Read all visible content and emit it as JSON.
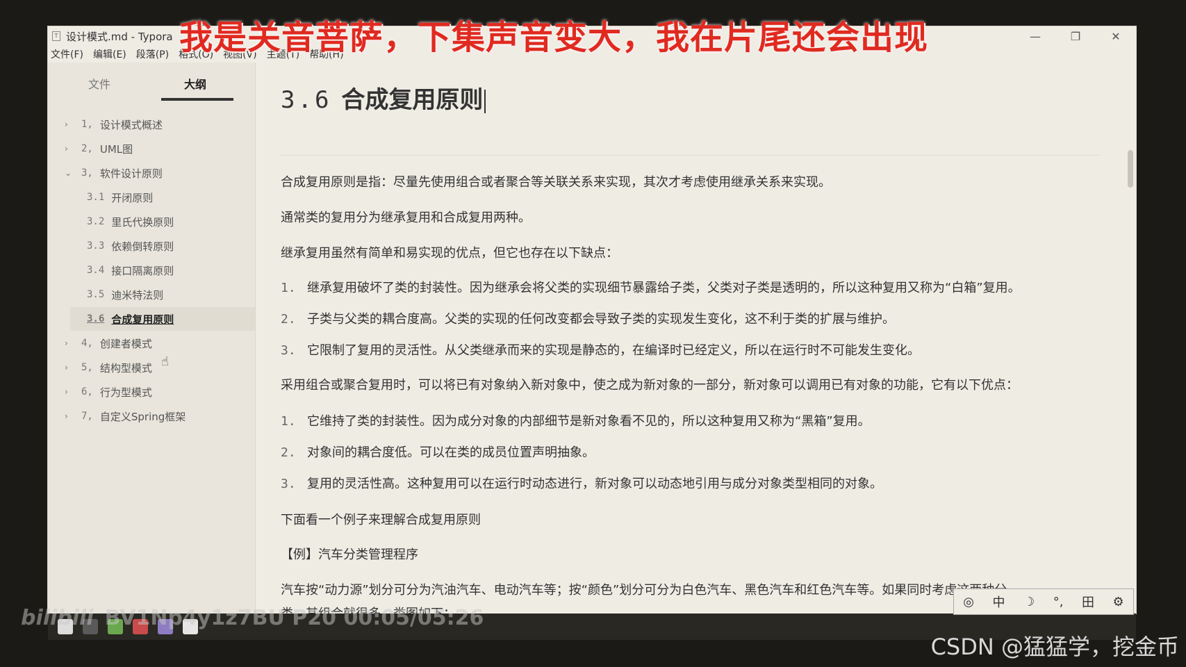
{
  "window": {
    "title": "设计模式.md - Typora"
  },
  "menu": [
    "文件(F)",
    "编辑(E)",
    "段落(P)",
    "格式(O)",
    "视图(V)",
    "主题(T)",
    "帮助(H)"
  ],
  "sidebar": {
    "tabs": [
      "文件",
      "大纲"
    ],
    "active_tab": "大纲",
    "outline": [
      {
        "arrow": "›",
        "num": "1,",
        "label": "设计模式概述"
      },
      {
        "arrow": "›",
        "num": "2,",
        "label": "UML图"
      },
      {
        "arrow": "⌄",
        "num": "3,",
        "label": "软件设计原则"
      },
      {
        "arrow": "",
        "num": "3.1",
        "label": "开闭原则"
      },
      {
        "arrow": "",
        "num": "3.2",
        "label": "里氏代换原则"
      },
      {
        "arrow": "",
        "num": "3.3",
        "label": "依赖倒转原则"
      },
      {
        "arrow": "",
        "num": "3.4",
        "label": "接口隔离原则"
      },
      {
        "arrow": "",
        "num": "3.5",
        "label": "迪米特法则"
      },
      {
        "arrow": "",
        "num": "3.6",
        "label": "合成复用原则"
      },
      {
        "arrow": "›",
        "num": "4,",
        "label": "创建者模式"
      },
      {
        "arrow": "›",
        "num": "5,",
        "label": "结构型模式"
      },
      {
        "arrow": "›",
        "num": "6,",
        "label": "行为型模式"
      },
      {
        "arrow": "›",
        "num": "7,",
        "label": "自定义Spring框架"
      }
    ]
  },
  "doc": {
    "heading_num": "3.6",
    "heading": "合成复用原则",
    "p1": "合成复用原则是指：尽量先使用组合或者聚合等关联关系来实现，其次才考虑使用继承关系来实现。",
    "p2": "通常类的复用分为继承复用和合成复用两种。",
    "p3": "继承复用虽然有简单和易实现的优点，但它也存在以下缺点：",
    "list1": [
      "继承复用破坏了类的封装性。因为继承会将父类的实现细节暴露给子类，父类对子类是透明的，所以这种复用又称为“白箱”复用。",
      "子类与父类的耦合度高。父类的实现的任何改变都会导致子类的实现发生变化，这不利于类的扩展与维护。",
      "它限制了复用的灵活性。从父类继承而来的实现是静态的，在编译时已经定义，所以在运行时不可能发生变化。"
    ],
    "p4": "采用组合或聚合复用时，可以将已有对象纳入新对象中，使之成为新对象的一部分，新对象可以调用已有对象的功能，它有以下优点：",
    "list2": [
      "它维持了类的封装性。因为成分对象的内部细节是新对象看不见的，所以这种复用又称为“黑箱”复用。",
      "对象间的耦合度低。可以在类的成员位置声明抽象。",
      "复用的灵活性高。这种复用可以在运行时动态进行，新对象可以动态地引用与成分对象类型相同的对象。"
    ],
    "p5": "下面看一个例子来理解合成复用原则",
    "p6": "【例】汽车分类管理程序",
    "p7a": "汽车按“动力源”划分可分为汽油汽车、电动汽车等；按“颜色”划分可分为白色汽车、黑色汽车和红色汽车等。如果同时考虑这两种分",
    "p7b": "类，其组合就很多。类图如下：",
    "footer": [
      "‹",
      "</>"
    ]
  },
  "overlay": {
    "banner": "我是关音菩萨，下集声音变大，我在片尾还会出现",
    "watermark_logo": "bilibili",
    "watermark_text": "BV1Np4y1z7BU P20 00:05/05:26",
    "ime": [
      "中",
      "☽",
      "°,",
      "田",
      "⚙"
    ],
    "credit": "CSDN @猛猛学，挖金币"
  }
}
